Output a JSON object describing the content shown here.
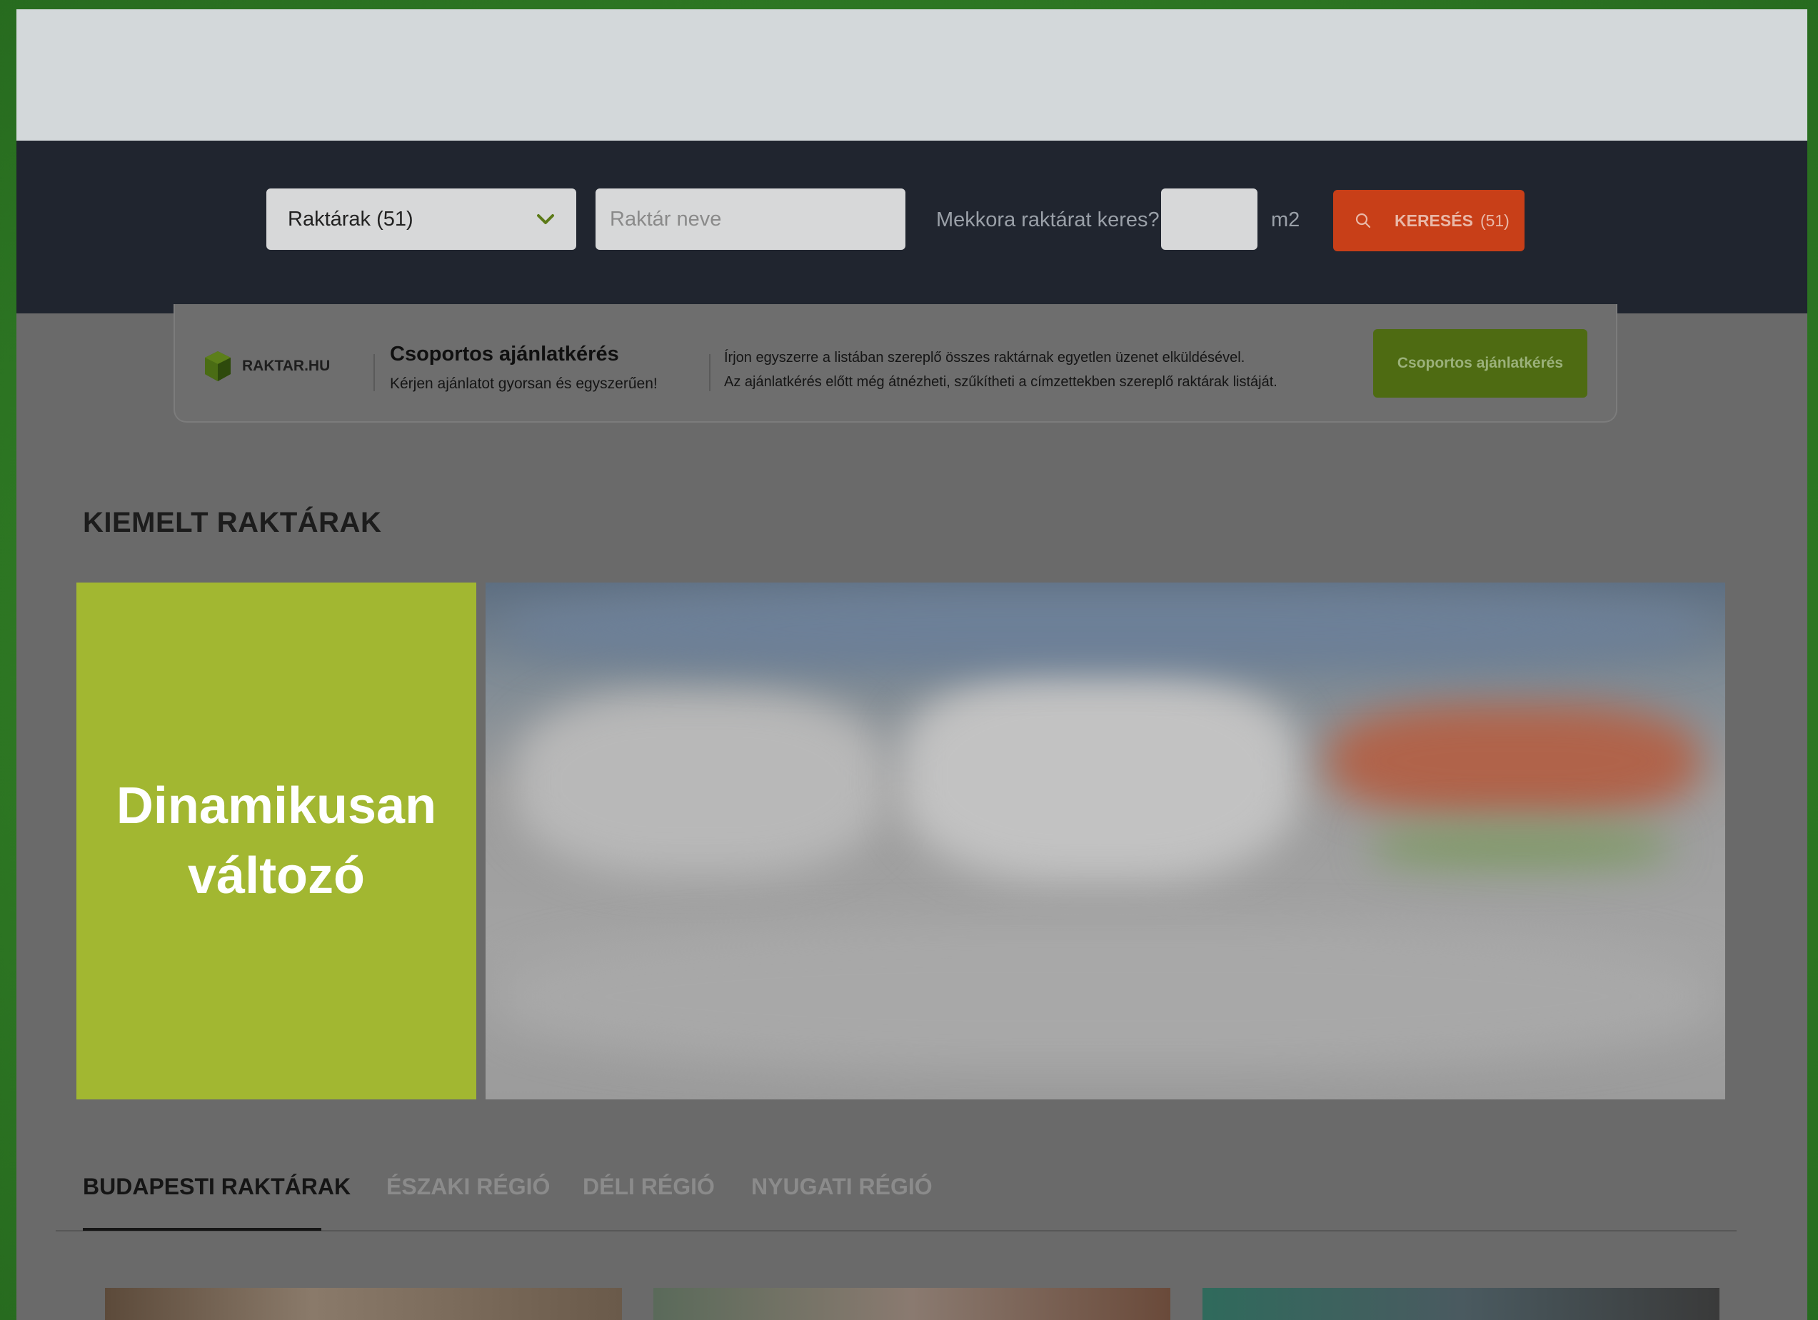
{
  "search": {
    "category_select": "Raktárak (51)",
    "name_placeholder": "Raktár neve",
    "size_question": "Mekkora raktárat keres?",
    "size_value": "",
    "size_unit": "m2",
    "button_label": "KERESÉS",
    "button_count": "(51)"
  },
  "group_offer": {
    "logo_text": "RAKTAR.HU",
    "title": "Csoportos ajánlatkérés",
    "subtitle": "Kérjen ajánlatot gyorsan és egyszerűen!",
    "description_line1": "Írjon egyszerre a listában szereplő összes raktárnak egyetlen üzenet elküldésével.",
    "description_line2": "Az ajánlatkérés előtt még átnézheti, szűkítheti a címzettekben szereplő raktárak listáját.",
    "button_label": "Csoportos ajánlatkérés"
  },
  "featured": {
    "heading": "KIEMELT RAKTÁRAK",
    "promo_text": "Dinamikusan változó"
  },
  "region_tabs": [
    {
      "label": "BUDAPESTI RAKTÁRAK",
      "active": true
    },
    {
      "label": "ÉSZAKI RÉGIÓ",
      "active": false
    },
    {
      "label": "DÉLI RÉGIÓ",
      "active": false
    },
    {
      "label": "NYUGATI RÉGIÓ",
      "active": false
    }
  ],
  "colors": {
    "accent_green": "#a2b731",
    "search_button": "#c83f18",
    "group_button": "#4e6b12",
    "dark_bar": "#20252f"
  }
}
